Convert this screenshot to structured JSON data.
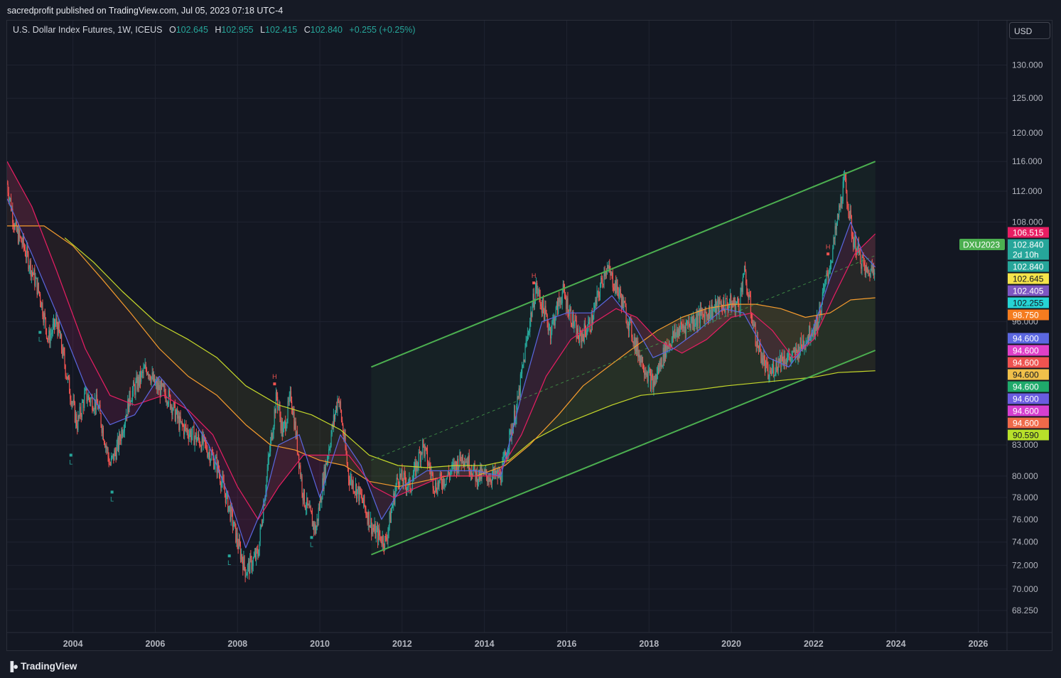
{
  "header": {
    "publisher": "sacredprofit published on TradingView.com, Jul 05, 2023 07:18 UTC-4"
  },
  "symbol_line": {
    "name": "U.S. Dollar Index Futures, 1W, ICEUS",
    "o_label": "O",
    "o_value": "102.645",
    "h_label": "H",
    "h_value": "102.955",
    "l_label": "L",
    "l_value": "102.415",
    "c_label": "C",
    "c_value": "102.840",
    "change": "+0.255 (+0.25%)"
  },
  "currency": "USD",
  "footer": {
    "logo_text": "TradingView"
  },
  "colors": {
    "channel": "#4caf50",
    "candle_up": "#26a69a",
    "candle_down": "#ef5350",
    "ma_blue": "#5b67e0",
    "ma_pink": "#e91e63",
    "ma_orange": "#f59b2e",
    "ma_yellow": "#c6d92a"
  },
  "chart_data": {
    "type": "line",
    "title": "",
    "xlabel": "",
    "ylabel": "",
    "x_ticks": [
      "2004",
      "2006",
      "2008",
      "2010",
      "2012",
      "2014",
      "2016",
      "2018",
      "2020",
      "2022",
      "2024",
      "2026"
    ],
    "y_ticks": [
      "130.000",
      "125.000",
      "120.000",
      "116.000",
      "112.000",
      "108.000",
      "96.000",
      "83.000",
      "80.000",
      "78.000",
      "76.000",
      "74.000",
      "72.000",
      "70.000",
      "68.250"
    ],
    "xlim": [
      2002.4,
      2026.7
    ],
    "ylim": [
      66.5,
      137
    ],
    "y_scale": "log",
    "series": [
      {
        "key": "price",
        "values": [
          [
            2002.4,
            113
          ],
          [
            2002.6,
            107
          ],
          [
            2002.8,
            105
          ],
          [
            2003.0,
            102
          ],
          [
            2003.2,
            99
          ],
          [
            2003.4,
            94
          ],
          [
            2003.6,
            96
          ],
          [
            2003.9,
            89
          ],
          [
            2004.1,
            85
          ],
          [
            2004.3,
            88
          ],
          [
            2004.6,
            87
          ],
          [
            2004.9,
            81
          ],
          [
            2005.1,
            83
          ],
          [
            2005.4,
            88
          ],
          [
            2005.8,
            91
          ],
          [
            2006.0,
            89
          ],
          [
            2006.3,
            88
          ],
          [
            2006.6,
            85
          ],
          [
            2006.9,
            84
          ],
          [
            2007.2,
            83
          ],
          [
            2007.5,
            81
          ],
          [
            2007.8,
            77
          ],
          [
            2008.0,
            74
          ],
          [
            2008.2,
            71.5
          ],
          [
            2008.5,
            73
          ],
          [
            2008.8,
            83
          ],
          [
            2008.95,
            88
          ],
          [
            2009.1,
            84
          ],
          [
            2009.3,
            88
          ],
          [
            2009.6,
            78
          ],
          [
            2009.9,
            75
          ],
          [
            2010.1,
            80
          ],
          [
            2010.45,
            88
          ],
          [
            2010.7,
            80
          ],
          [
            2011.0,
            78
          ],
          [
            2011.3,
            75
          ],
          [
            2011.6,
            74
          ],
          [
            2011.9,
            80
          ],
          [
            2012.2,
            79
          ],
          [
            2012.5,
            83
          ],
          [
            2012.8,
            79
          ],
          [
            2013.1,
            80
          ],
          [
            2013.5,
            82
          ],
          [
            2013.8,
            80
          ],
          [
            2014.1,
            80
          ],
          [
            2014.4,
            80
          ],
          [
            2014.8,
            87
          ],
          [
            2015.1,
            96
          ],
          [
            2015.25,
            100
          ],
          [
            2015.6,
            95
          ],
          [
            2015.9,
            99.5
          ],
          [
            2016.3,
            94
          ],
          [
            2016.6,
            96
          ],
          [
            2016.95,
            102.5
          ],
          [
            2017.3,
            99
          ],
          [
            2017.7,
            93
          ],
          [
            2018.1,
            89
          ],
          [
            2018.4,
            93
          ],
          [
            2018.7,
            95
          ],
          [
            2019.0,
            96
          ],
          [
            2019.4,
            97
          ],
          [
            2019.8,
            98
          ],
          [
            2020.2,
            98
          ],
          [
            2020.3,
            102
          ],
          [
            2020.6,
            94
          ],
          [
            2020.9,
            90
          ],
          [
            2021.2,
            92
          ],
          [
            2021.5,
            92
          ],
          [
            2021.8,
            94
          ],
          [
            2022.1,
            96
          ],
          [
            2022.45,
            104
          ],
          [
            2022.75,
            113.5
          ],
          [
            2022.95,
            106
          ],
          [
            2023.1,
            104
          ],
          [
            2023.3,
            101.5
          ],
          [
            2023.5,
            102.84
          ]
        ]
      },
      {
        "key": "ma_blue",
        "values": [
          [
            2002.4,
            111
          ],
          [
            2003.0,
            104
          ],
          [
            2003.6,
            97
          ],
          [
            2004.3,
            89
          ],
          [
            2004.9,
            85
          ],
          [
            2005.5,
            86
          ],
          [
            2006.1,
            90
          ],
          [
            2006.7,
            87
          ],
          [
            2007.3,
            83
          ],
          [
            2007.8,
            78
          ],
          [
            2008.2,
            73.5
          ],
          [
            2008.6,
            77
          ],
          [
            2009.0,
            83
          ],
          [
            2009.5,
            84
          ],
          [
            2010.0,
            78
          ],
          [
            2010.5,
            84
          ],
          [
            2011.0,
            81
          ],
          [
            2011.5,
            76
          ],
          [
            2012.0,
            79
          ],
          [
            2012.6,
            80.5
          ],
          [
            2013.2,
            80.5
          ],
          [
            2013.8,
            80.5
          ],
          [
            2014.4,
            80
          ],
          [
            2014.9,
            88
          ],
          [
            2015.4,
            96
          ],
          [
            2016.0,
            97
          ],
          [
            2016.6,
            97
          ],
          [
            2017.1,
            99
          ],
          [
            2017.6,
            96
          ],
          [
            2018.1,
            92
          ],
          [
            2018.6,
            93
          ],
          [
            2019.2,
            95
          ],
          [
            2019.8,
            97.5
          ],
          [
            2020.3,
            97
          ],
          [
            2020.9,
            92
          ],
          [
            2021.4,
            91
          ],
          [
            2021.9,
            94
          ],
          [
            2022.4,
            101
          ],
          [
            2022.9,
            108
          ],
          [
            2023.2,
            104
          ],
          [
            2023.5,
            102.4
          ]
        ]
      },
      {
        "key": "ma_pink",
        "values": [
          [
            2002.4,
            116
          ],
          [
            2003.0,
            110
          ],
          [
            2003.6,
            102
          ],
          [
            2004.3,
            93
          ],
          [
            2004.9,
            88
          ],
          [
            2005.5,
            87
          ],
          [
            2006.2,
            88
          ],
          [
            2006.8,
            86.5
          ],
          [
            2007.4,
            84
          ],
          [
            2008.0,
            79
          ],
          [
            2008.5,
            76
          ],
          [
            2009.0,
            79
          ],
          [
            2009.6,
            82
          ],
          [
            2010.1,
            82
          ],
          [
            2010.7,
            82
          ],
          [
            2011.3,
            79
          ],
          [
            2011.8,
            78
          ],
          [
            2012.4,
            79
          ],
          [
            2013.0,
            80
          ],
          [
            2013.7,
            80
          ],
          [
            2014.3,
            80
          ],
          [
            2014.9,
            84
          ],
          [
            2015.5,
            90
          ],
          [
            2016.1,
            94
          ],
          [
            2016.7,
            96
          ],
          [
            2017.2,
            97.5
          ],
          [
            2017.7,
            96.5
          ],
          [
            2018.2,
            94
          ],
          [
            2018.8,
            92.5
          ],
          [
            2019.4,
            94
          ],
          [
            2020.0,
            96.5
          ],
          [
            2020.5,
            97
          ],
          [
            2021.0,
            95
          ],
          [
            2021.5,
            92
          ],
          [
            2022.0,
            94
          ],
          [
            2022.5,
            99
          ],
          [
            2023.0,
            104
          ],
          [
            2023.5,
            106.5
          ]
        ]
      },
      {
        "key": "ma_orange",
        "values": [
          [
            2002.4,
            107.5
          ],
          [
            2003.3,
            107.5
          ],
          [
            2004.0,
            105
          ],
          [
            2004.7,
            101
          ],
          [
            2005.4,
            97
          ],
          [
            2006.1,
            93
          ],
          [
            2006.8,
            90
          ],
          [
            2007.5,
            88
          ],
          [
            2008.2,
            85
          ],
          [
            2008.8,
            83
          ],
          [
            2009.4,
            82.5
          ],
          [
            2010.0,
            81.5
          ],
          [
            2010.6,
            81
          ],
          [
            2011.2,
            79.5
          ],
          [
            2011.9,
            79
          ],
          [
            2012.5,
            79.5
          ],
          [
            2013.1,
            80
          ],
          [
            2013.8,
            80
          ],
          [
            2014.5,
            81
          ],
          [
            2015.1,
            83
          ],
          [
            2015.8,
            86
          ],
          [
            2016.4,
            89
          ],
          [
            2017.0,
            91
          ],
          [
            2017.6,
            93
          ],
          [
            2018.2,
            95
          ],
          [
            2018.8,
            96.5
          ],
          [
            2019.4,
            97.5
          ],
          [
            2020.0,
            98
          ],
          [
            2020.6,
            98
          ],
          [
            2021.2,
            97.5
          ],
          [
            2021.8,
            96.5
          ],
          [
            2022.4,
            97
          ],
          [
            2022.9,
            98.5
          ],
          [
            2023.5,
            98.75
          ]
        ]
      },
      {
        "key": "ma_yellow",
        "values": [
          [
            2003.8,
            106
          ],
          [
            2004.5,
            103
          ],
          [
            2005.2,
            99.5
          ],
          [
            2006.0,
            96
          ],
          [
            2006.8,
            94
          ],
          [
            2007.5,
            92
          ],
          [
            2008.2,
            89
          ],
          [
            2009.0,
            87
          ],
          [
            2009.8,
            86
          ],
          [
            2010.5,
            84.5
          ],
          [
            2011.2,
            82
          ],
          [
            2011.9,
            81
          ],
          [
            2012.6,
            80.8
          ],
          [
            2013.3,
            81
          ],
          [
            2014.0,
            81
          ],
          [
            2014.6,
            81.5
          ],
          [
            2015.2,
            83.5
          ],
          [
            2015.9,
            85
          ],
          [
            2016.5,
            86
          ],
          [
            2017.1,
            87
          ],
          [
            2017.8,
            88
          ],
          [
            2018.5,
            88.3
          ],
          [
            2019.2,
            88.6
          ],
          [
            2019.9,
            89
          ],
          [
            2020.6,
            89.3
          ],
          [
            2021.3,
            89.6
          ],
          [
            2022.0,
            89.9
          ],
          [
            2022.6,
            90.4
          ],
          [
            2023.1,
            90.5
          ],
          [
            2023.5,
            90.59
          ]
        ]
      },
      {
        "key": "channel_upper",
        "values": [
          [
            2011.25,
            91.0
          ],
          [
            2023.5,
            116.0
          ]
        ]
      },
      {
        "key": "channel_lower",
        "values": [
          [
            2011.25,
            72.9
          ],
          [
            2023.5,
            92.8
          ]
        ]
      },
      {
        "key": "channel_mid",
        "values": [
          [
            2011.25,
            81.5
          ],
          [
            2023.5,
            103.8
          ]
        ]
      }
    ],
    "markers": [
      {
        "x": 2003.2,
        "y": 94.8,
        "label": "L",
        "side": "below"
      },
      {
        "x": 2003.95,
        "y": 82.0,
        "label": "L",
        "side": "below"
      },
      {
        "x": 2004.95,
        "y": 78.5,
        "label": "L",
        "side": "below"
      },
      {
        "x": 2007.8,
        "y": 72.8,
        "label": "L",
        "side": "below"
      },
      {
        "x": 2009.8,
        "y": 74.4,
        "label": "L",
        "side": "below"
      },
      {
        "x": 2008.9,
        "y": 89.2,
        "label": "H",
        "side": "above"
      },
      {
        "x": 2015.2,
        "y": 100.5,
        "label": "H",
        "side": "above"
      },
      {
        "x": 2022.35,
        "y": 104.0,
        "label": "H",
        "side": "above"
      }
    ],
    "contract_label": "DXU2023",
    "price_labels": [
      {
        "text": "106.515",
        "bg": "#e91e63",
        "color": "#ffffff"
      },
      {
        "text": "102.840",
        "bg": "#26a69a",
        "color": "#ffffff"
      },
      {
        "text": "2d 10h",
        "bg": "#26a69a",
        "color": "#ffffff"
      },
      {
        "text": "102.840",
        "bg": "#26a69a",
        "color": "#ffffff"
      },
      {
        "text": "102.645",
        "bg": "#f5e44a",
        "color": "#131722"
      },
      {
        "text": "102.405",
        "bg": "#7e57c2",
        "color": "#ffffff"
      },
      {
        "text": "102.255",
        "bg": "#26d4d4",
        "color": "#131722"
      },
      {
        "text": "98.750",
        "bg": "#f57c1f",
        "color": "#ffffff"
      },
      {
        "text": "94.600",
        "bg": "#5b67e0",
        "color": "#ffffff"
      },
      {
        "text": "94.600",
        "bg": "#e040c8",
        "color": "#ffffff"
      },
      {
        "text": "94.600",
        "bg": "#ef5350",
        "color": "#ffffff"
      },
      {
        "text": "94.600",
        "bg": "#f0c04a",
        "color": "#131722"
      },
      {
        "text": "94.600",
        "bg": "#1faa6b",
        "color": "#ffffff"
      },
      {
        "text": "94.600",
        "bg": "#6a5ce0",
        "color": "#ffffff"
      },
      {
        "text": "94.600",
        "bg": "#d63fcf",
        "color": "#ffffff"
      },
      {
        "text": "94.600",
        "bg": "#f06a4a",
        "color": "#ffffff"
      },
      {
        "text": "90.590",
        "bg": "#b8e02a",
        "color": "#131722"
      }
    ]
  }
}
